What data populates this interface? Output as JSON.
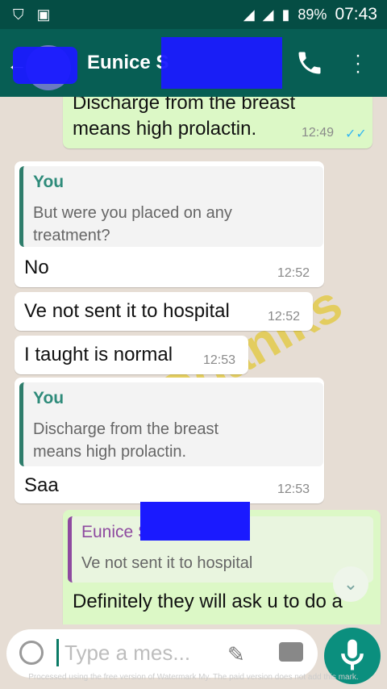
{
  "status_bar": {
    "battery": "89%",
    "time": "07:43"
  },
  "header": {
    "contact_name": "Eunice S"
  },
  "messages": {
    "m1": {
      "text_line1": "Discharge from the breast",
      "text_line2": "means high prolactin.",
      "time": "12:49",
      "ticks": "✓✓"
    },
    "m2": {
      "quote_name": "You",
      "quote_line1": "But were you placed on any",
      "quote_line2": "treatment?",
      "text": "No",
      "time": "12:52"
    },
    "m3": {
      "text": "Ve not sent it to hospital",
      "time": "12:52"
    },
    "m4": {
      "text": "I taught is normal",
      "time": "12:53"
    },
    "m5": {
      "quote_name": "You",
      "quote_line1": "Discharge from the breast",
      "quote_line2": "means high prolactin.",
      "text": "Saa",
      "time": "12:53"
    },
    "m6": {
      "quote_name": "Eunice S",
      "quote_line1": "Ve not sent it to hospital",
      "text": "Definitely they will ask u to do a"
    }
  },
  "watermark": "AfrOganiks",
  "composer": {
    "placeholder": "Type a mes..."
  },
  "footer_text": "Processed using the free version of Watermark My. The paid version does not add this mark."
}
